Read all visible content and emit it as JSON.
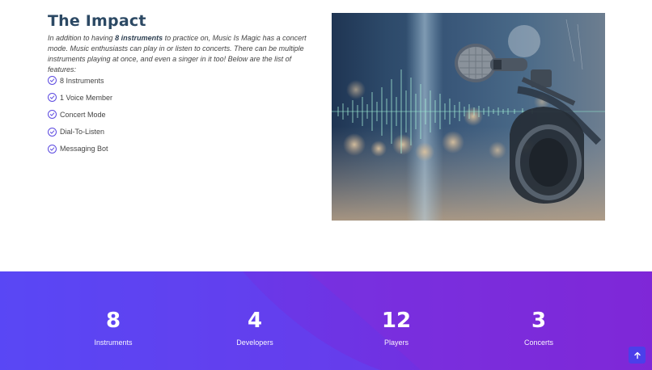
{
  "about": {
    "title": "The Impact",
    "intro_before": "In addition to having ",
    "intro_bold": "8 instruments",
    "intro_after": " to practice on, Music Is Magic has a concert mode. Music enthusiasts can play in or listen to concerts. There can be multiple instruments playing at once, and even a singer in it too! Below are the list of features:",
    "features": [
      "8 Instruments",
      "1 Voice Member",
      "Concert Mode",
      "Dial-To-Listen",
      "Messaging Bot"
    ],
    "feature_icon": "check-circle-icon",
    "accent_color": "#5c4ae0"
  },
  "hero_image": {
    "subject": "microphone-headphones-soundwave-photo"
  },
  "stats": [
    {
      "value": "8",
      "label": "Instruments"
    },
    {
      "value": "4",
      "label": "Developers"
    },
    {
      "value": "12",
      "label": "Players"
    },
    {
      "value": "3",
      "label": "Concerts"
    }
  ],
  "stats_gradient": [
    "#5846f4",
    "#7a26d8"
  ],
  "back_to_top": {
    "icon": "arrow-up-icon",
    "color": "#4b3fea"
  }
}
